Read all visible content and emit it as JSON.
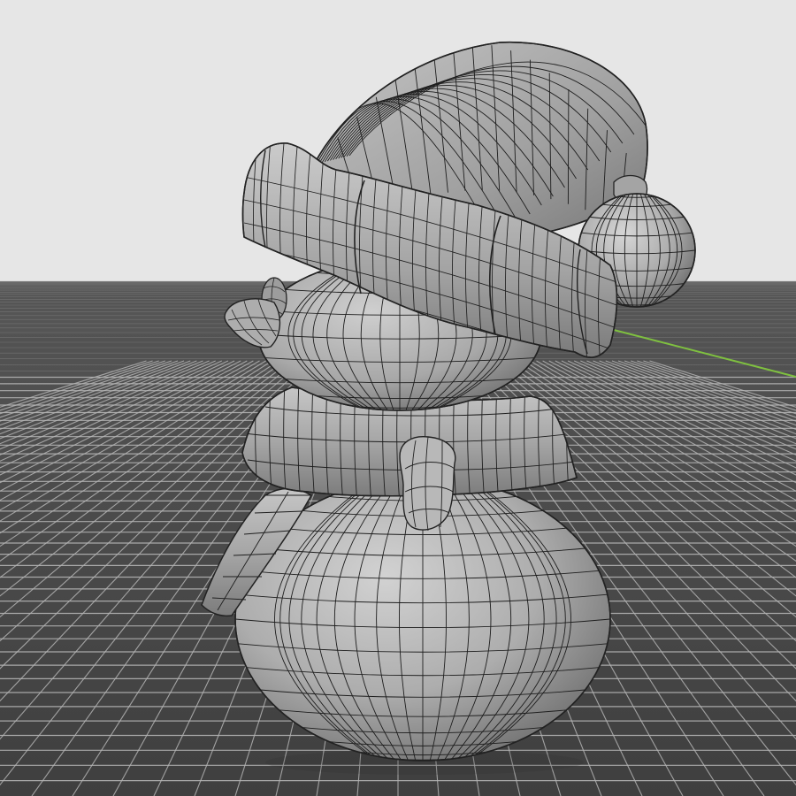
{
  "viewport": {
    "background_color": "#e6e6e6",
    "floor_color": "#4a4a4a",
    "floor_far_color": "#555555",
    "grid_line_color": "#8c8c8c",
    "grid_line_bright": "#b4b4b4",
    "x_axis_color": "#7fc040",
    "mesh_base_color": "#a9a9a9",
    "mesh_light_color": "#c6c6c6",
    "mesh_dark_color": "#6e6e6e",
    "wire_color": "#1e1e1e"
  },
  "model": {
    "name_icon": "snowman-mesh",
    "parts": [
      "hat",
      "hat-brim",
      "pompom",
      "head",
      "nose",
      "eye",
      "scarf",
      "scarf-tail",
      "scarf-knot",
      "body"
    ]
  }
}
